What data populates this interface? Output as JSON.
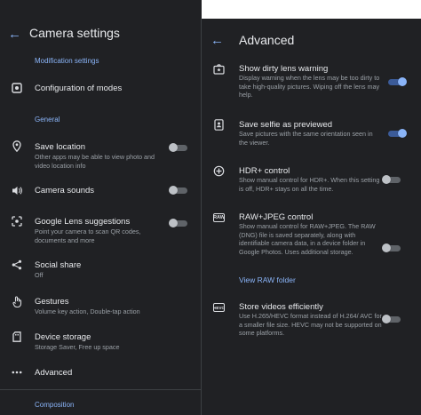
{
  "left": {
    "title": "Camera settings",
    "sections": {
      "modification": "Modification settings",
      "general": "General",
      "composition": "Composition"
    },
    "items": {
      "config_modes": {
        "title": "Configuration of modes",
        "icon": "tune-icon"
      },
      "save_location": {
        "title": "Save location",
        "subtitle": "Other apps may be able to view photo and video location info",
        "toggle": "off",
        "icon": "location-pin-icon"
      },
      "camera_sounds": {
        "title": "Camera sounds",
        "toggle": "off",
        "icon": "volume-icon"
      },
      "lens_suggestions": {
        "title": "Google Lens suggestions",
        "subtitle": "Point your camera to scan QR codes, documents and more",
        "toggle": "off",
        "icon": "lens-icon"
      },
      "social_share": {
        "title": "Social share",
        "subtitle": "Off",
        "icon": "share-icon"
      },
      "gestures": {
        "title": "Gestures",
        "subtitle": "Volume key action, Double-tap action",
        "icon": "gesture-hand-icon"
      },
      "device_storage": {
        "title": "Device storage",
        "subtitle": "Storage Saver, Free up space",
        "icon": "storage-icon"
      },
      "advanced": {
        "title": "Advanced",
        "icon": "more-dots-icon"
      }
    }
  },
  "right": {
    "title": "Advanced",
    "items": {
      "dirty_lens": {
        "title": "Show dirty lens warning",
        "subtitle": "Display warning when the lens may be too dirty to take high-quality pictures. Wiping off the lens may help.",
        "toggle": "on",
        "icon": "dirty-lens-icon"
      },
      "selfie": {
        "title": "Save selfie as previewed",
        "subtitle": "Save pictures with the same orientation seen in the viewer.",
        "toggle": "on",
        "icon": "selfie-icon"
      },
      "hdr": {
        "title": "HDR+ control",
        "subtitle": "Show manual control for HDR+. When this setting is off, HDR+ stays on all the time.",
        "toggle": "off",
        "icon": "hdr-icon"
      },
      "raw": {
        "title": "RAW+JPEG control",
        "subtitle": "Show manual control for RAW+JPEG. The RAW (DNG) file is saved separately, along with identifiable camera data, in a device folder in Google Photos. Uses additional storage.",
        "toggle": "off",
        "icon": "raw-icon",
        "icon_text": "RAW",
        "link": "View RAW folder"
      },
      "hevc": {
        "title": "Store videos efficiently",
        "subtitle": "Use H.265/HEVC format instead of H.264/ AVC for a smaller file size. HEVC may not be supported on some platforms.",
        "toggle": "off",
        "icon": "hevc-icon",
        "icon_text": "HEVC"
      }
    }
  },
  "colors": {
    "background": "#202124",
    "accent": "#8ab4f8",
    "text": "#e8eaed",
    "secondary": "#9aa0a6"
  }
}
